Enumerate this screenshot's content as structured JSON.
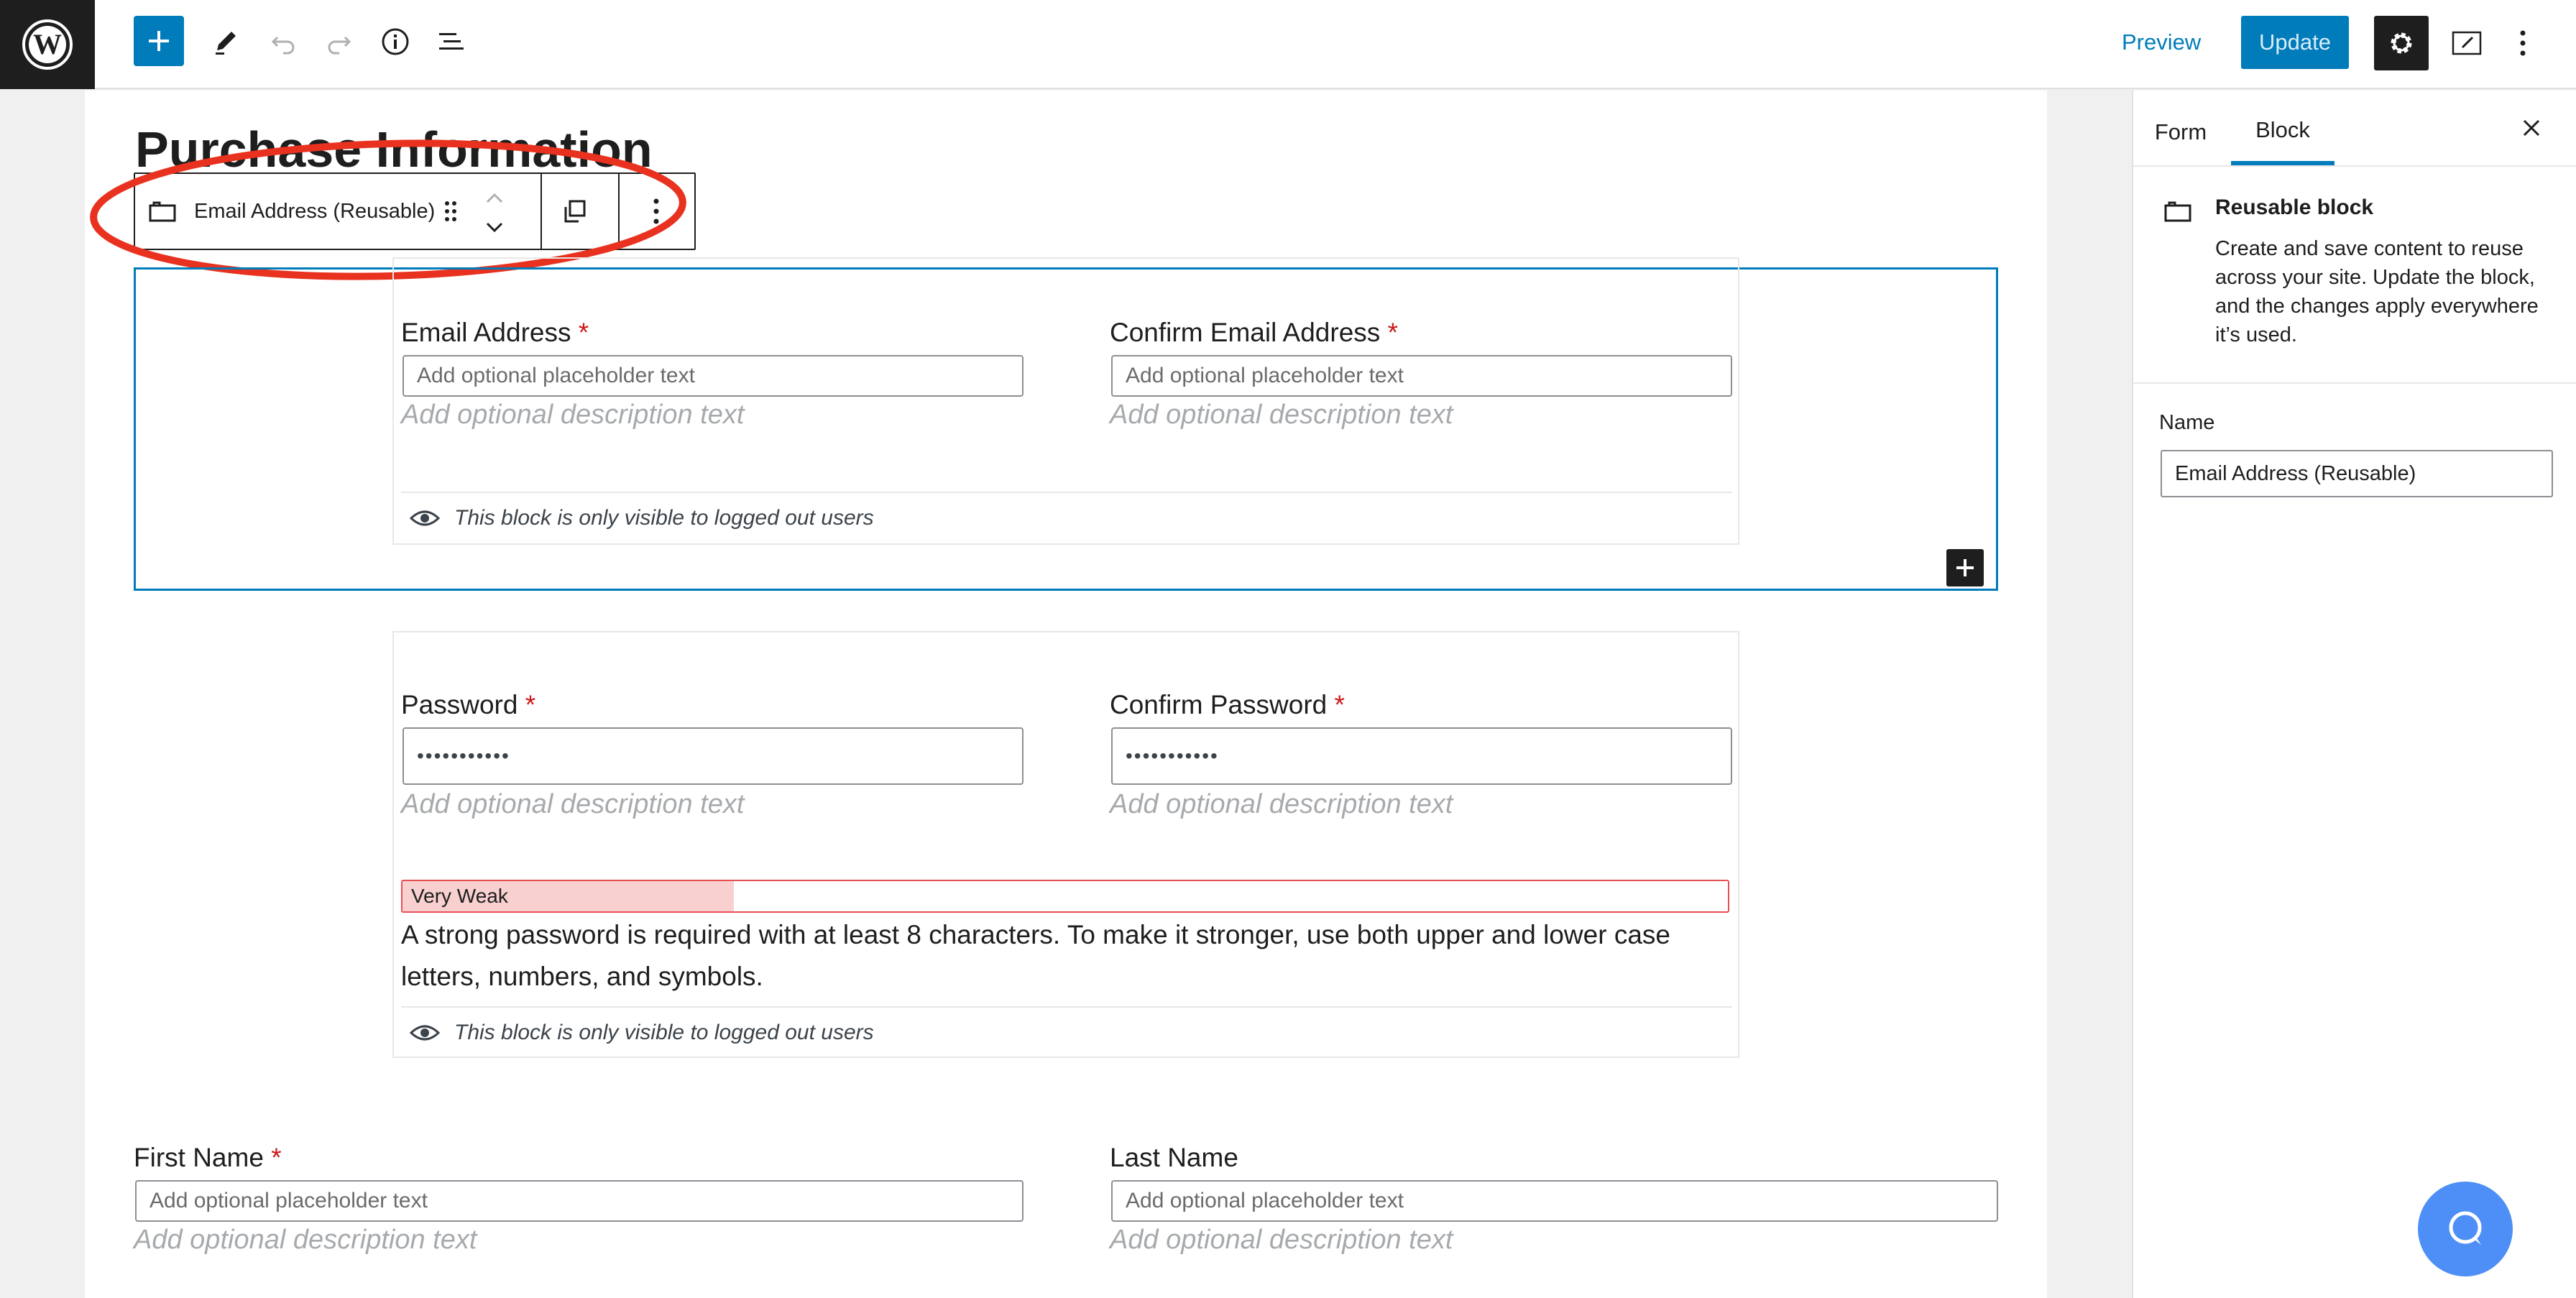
{
  "toolbar": {
    "preview_label": "Preview",
    "update_label": "Update"
  },
  "page": {
    "title": "Purchase Information"
  },
  "block_toolbar": {
    "block_name": "Email Address (Reusable)"
  },
  "email_block": {
    "email_label": "Email Address",
    "confirm_email_label": "Confirm Email Address",
    "required_mark": "*",
    "placeholder": "Add optional placeholder text",
    "description": "Add optional description text",
    "visibility_note": "This block is only visible to logged out users"
  },
  "password_block": {
    "password_label": "Password",
    "confirm_password_label": "Confirm Password",
    "password_value": "•••••••••••",
    "confirm_password_value": "•••••••••••",
    "description": "Add optional description text",
    "strength_label": "Very Weak",
    "strength_fraction": 0.25,
    "hint": "A strong password is required with at least 8 characters. To make it stronger, use both upper and lower case letters, numbers, and symbols.",
    "visibility_note": "This block is only visible to logged out users"
  },
  "name_block": {
    "first_name_label": "First Name",
    "last_name_label": "Last Name",
    "placeholder": "Add optional placeholder text",
    "description": "Add optional description text"
  },
  "sidebar": {
    "tabs": [
      "Form",
      "Block"
    ],
    "active_tab": "Block",
    "block_title": "Reusable block",
    "block_description": "Create and save content to reuse across your site. Update the block, and the changes apply everywhere it’s used.",
    "name_label": "Name",
    "name_value": "Email Address (Reusable)"
  },
  "colors": {
    "accent": "#007cba",
    "annotation": "#e8321f",
    "required": "#cc1818",
    "strength_fill": "#f8d0d0",
    "strength_border": "#e65054"
  },
  "icons": [
    "wordpress-logo-icon",
    "plus-icon",
    "pencil-icon",
    "undo-icon",
    "redo-icon",
    "info-icon",
    "list-view-icon",
    "gear-icon",
    "editor-panel-icon",
    "more-vertical-icon",
    "reusable-block-icon",
    "drag-handle-icon",
    "move-up-icon",
    "move-down-icon",
    "duplicate-icon",
    "eye-icon",
    "close-icon",
    "help-chat-icon"
  ]
}
